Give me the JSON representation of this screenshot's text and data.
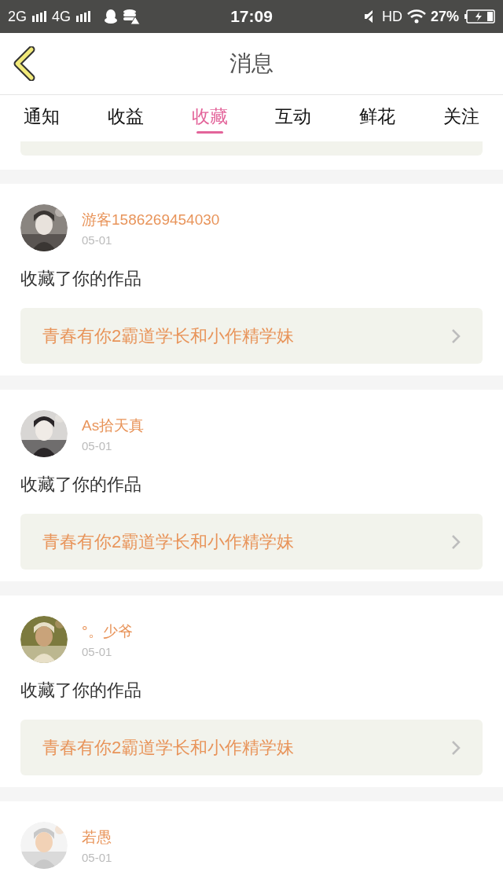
{
  "status_bar": {
    "network_1": "2G",
    "network_2": "4G",
    "time": "17:09",
    "hd": "HD",
    "battery": "27%"
  },
  "header": {
    "title": "消息"
  },
  "tabs": [
    {
      "label": "通知",
      "selected": false
    },
    {
      "label": "收益",
      "selected": false
    },
    {
      "label": "收藏",
      "selected": true
    },
    {
      "label": "互动",
      "selected": false
    },
    {
      "label": "鲜花",
      "selected": false
    },
    {
      "label": "关注",
      "selected": false
    }
  ],
  "notifications": [
    {
      "user": "游客1586269454030",
      "date": "05-01",
      "action": "收藏了你的作品",
      "work": "青春有你2霸道学长和小作精学妹"
    },
    {
      "user": "As拾天真",
      "date": "05-01",
      "action": "收藏了你的作品",
      "work": "青春有你2霸道学长和小作精学妹"
    },
    {
      "user": "°。少爷",
      "date": "05-01",
      "action": "收藏了你的作品",
      "work": "青春有你2霸道学长和小作精学妹"
    },
    {
      "user": "若愚",
      "date": "05-01"
    }
  ]
}
